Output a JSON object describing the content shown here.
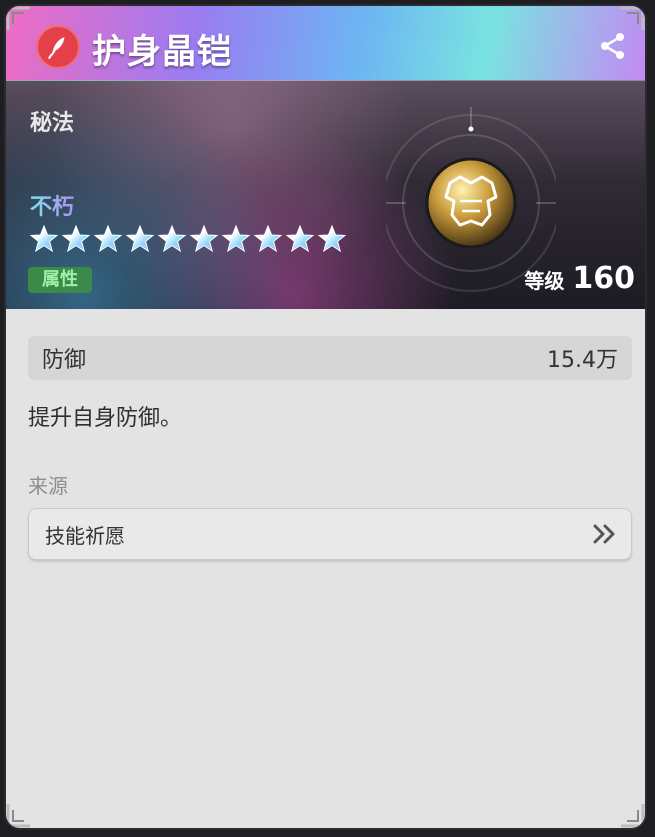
{
  "header": {
    "title": "护身晶铠",
    "share_icon": "share-icon",
    "badge_icon": "quill-icon",
    "badge_color": "#e5404a"
  },
  "banner": {
    "type_label": "秘法",
    "rank_label": "不朽",
    "star_count": 10,
    "attribute_badge": "属性",
    "level_label": "等级",
    "level_value": "160",
    "emblem_icon": "chest-armor-icon"
  },
  "stat": {
    "name": "防御",
    "value": "15.4万"
  },
  "description": "提升自身防御。",
  "source": {
    "title": "来源",
    "item_label": "技能祈愿",
    "action_icon": "double-chevron-right-icon"
  }
}
